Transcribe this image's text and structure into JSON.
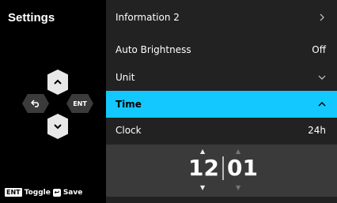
{
  "title": "Settings",
  "dpad": {
    "enter_label": "ENT"
  },
  "footer": {
    "toggle_key": "ENT",
    "toggle_label": "Toggle",
    "save_label": "Save"
  },
  "rows": [
    {
      "label": "Information 2",
      "value": ""
    },
    {
      "label": "Auto Brightness",
      "value": "Off"
    },
    {
      "label": "Unit",
      "value": ""
    },
    {
      "label": "Time",
      "value": ""
    },
    {
      "label": "Clock",
      "value": "24h"
    }
  ],
  "time": {
    "hours": "12",
    "minutes": "01"
  },
  "colors": {
    "accent": "#12c8ff",
    "panel": "#222222",
    "editor": "#3a3a3a"
  }
}
